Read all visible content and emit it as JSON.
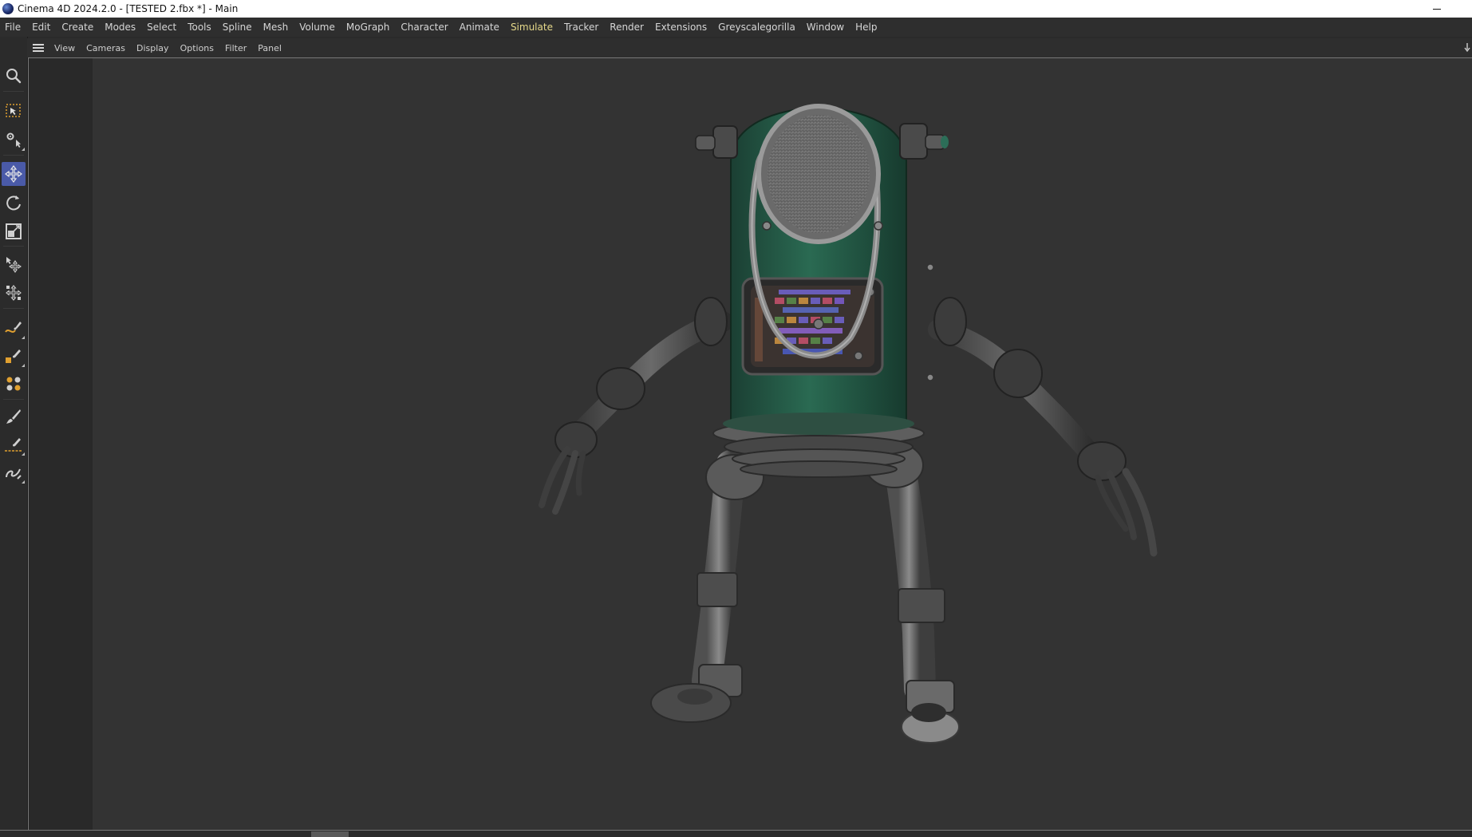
{
  "window": {
    "title": "Cinema 4D 2024.2.0 - [TESTED 2.fbx *] - Main",
    "app_icon": "cinema4d-logo-icon",
    "controls": [
      "minimize-icon"
    ]
  },
  "menubar": {
    "items": [
      {
        "label": "File"
      },
      {
        "label": "Edit"
      },
      {
        "label": "Create"
      },
      {
        "label": "Modes"
      },
      {
        "label": "Select"
      },
      {
        "label": "Tools"
      },
      {
        "label": "Spline"
      },
      {
        "label": "Mesh"
      },
      {
        "label": "Volume"
      },
      {
        "label": "MoGraph"
      },
      {
        "label": "Character"
      },
      {
        "label": "Animate"
      },
      {
        "label": "Simulate",
        "active": true
      },
      {
        "label": "Tracker"
      },
      {
        "label": "Render"
      },
      {
        "label": "Extensions"
      },
      {
        "label": "Greyscalegorilla"
      },
      {
        "label": "Window"
      },
      {
        "label": "Help"
      }
    ],
    "active_color": "#e6d98a"
  },
  "viewport_header": {
    "menu_icon": "hamburger-icon",
    "items": [
      "View",
      "Cameras",
      "Display",
      "Options",
      "Filter",
      "Panel"
    ]
  },
  "toolbar": {
    "tools": [
      {
        "name": "zoom-tool",
        "icon": "magnifier-icon"
      },
      {
        "name": "rectangle-select-tool",
        "icon": "rectangle-selection-icon"
      },
      {
        "name": "live-selection-tool",
        "icon": "gear-cursor-icon"
      },
      {
        "name": "move-tool",
        "icon": "move-arrows-icon",
        "active": true
      },
      {
        "name": "rotate-tool",
        "icon": "rotate-icon"
      },
      {
        "name": "scale-tool",
        "icon": "scale-icon"
      },
      {
        "name": "placement-tool",
        "icon": "placement-arrows-icon"
      },
      {
        "name": "transform-tool",
        "icon": "transform-icon"
      },
      {
        "name": "spline-pen-tool",
        "icon": "spline-pen-icon"
      },
      {
        "name": "object-pen-tool",
        "icon": "object-pen-icon"
      },
      {
        "name": "generators-tool",
        "icon": "generators-icon"
      },
      {
        "name": "brush-tool",
        "icon": "brush-icon"
      },
      {
        "name": "line-pen-tool",
        "icon": "line-pen-icon"
      },
      {
        "name": "sketch-tool",
        "icon": "sketch-icon"
      }
    ],
    "active_color": "#4a5aa8"
  },
  "viewport": {
    "content": "robot-model",
    "body_color": "#1f5a45"
  }
}
